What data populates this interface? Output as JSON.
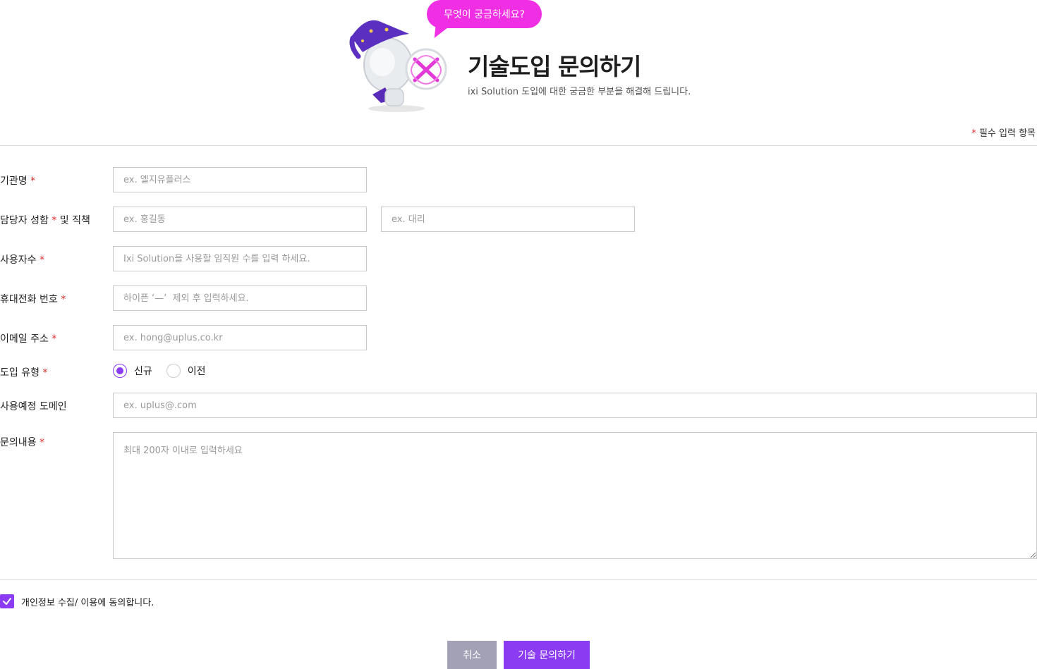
{
  "header": {
    "bubble_text": "무엇이 궁금하세요?",
    "title": "기술도입 문의하기",
    "subtitle": "ixi Solution 도입에 대한 궁금한 부분을 해결해 드립니다."
  },
  "required_note": {
    "star": "*",
    "label": "필수 입력 항목"
  },
  "form": {
    "org_name": {
      "label": "기관명",
      "star": "*",
      "placeholder": "ex. 엘지유플러스"
    },
    "contact": {
      "label_before": "담당자 성함",
      "star": "*",
      "label_after": "및 직책",
      "name_placeholder": "ex. 홍길동",
      "position_placeholder": "ex. 대리"
    },
    "users": {
      "label": "사용자수",
      "star": "*",
      "placeholder": "Ixi Solution을 사용할 임직원 수를 입력 하세요."
    },
    "phone": {
      "label": "휴대전화 번호",
      "star": "*",
      "placeholder": "하이픈 ‘—’  제외 후 입력하세요."
    },
    "email": {
      "label": "이메일 주소",
      "star": "*",
      "placeholder": "ex. hong@uplus.co.kr"
    },
    "intro_type": {
      "label": "도입 유형",
      "star": "*",
      "options": [
        "신규",
        "이전"
      ],
      "selected": "신규"
    },
    "domain": {
      "label": "사용예정 도메인",
      "placeholder": "ex. uplus@.com"
    },
    "inquiry": {
      "label": "문의내용",
      "star": "*",
      "placeholder": "최대 200자 이내로 입력하세요"
    }
  },
  "agreement": {
    "label": "개인정보  수집/ 이용에 동의합니다.",
    "checked": true
  },
  "buttons": {
    "cancel": "취소",
    "submit": "기술 문의하기"
  },
  "colors": {
    "accent": "#8b3cf3",
    "bubble": "#f02fe4",
    "required": "#e02a2a",
    "cancel": "#a3a1b5"
  }
}
